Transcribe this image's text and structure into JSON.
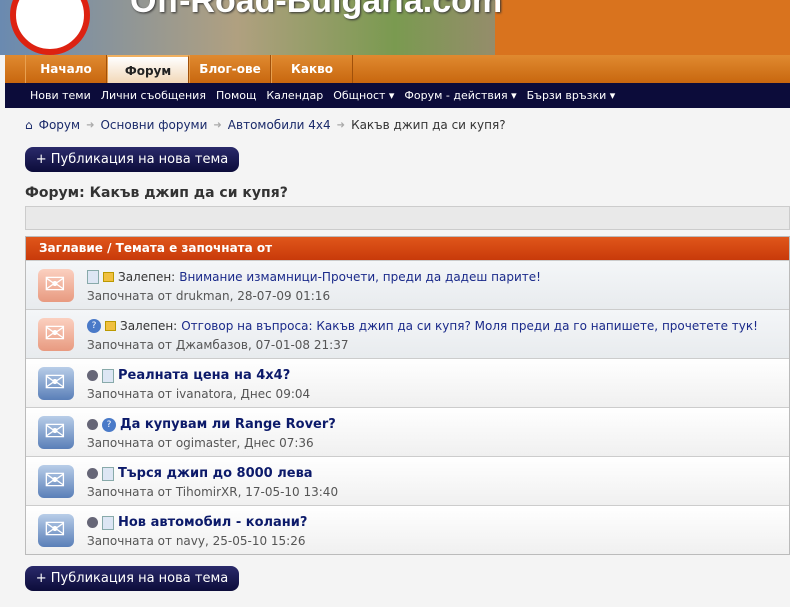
{
  "site": {
    "title": "Off-Road-Bulgaria.com"
  },
  "tabs": [
    "Начало",
    "Форум",
    "Блог-ове",
    "Какво ново?"
  ],
  "subnav": [
    "Нови теми",
    "Лични съобщения",
    "Помощ",
    "Календар",
    "Общност ▾",
    "Форум - действия ▾",
    "Бързи връзки ▾"
  ],
  "breadcrumb": [
    "Форум",
    "Основни форуми",
    "Автомобили 4x4",
    "Какъв джип да си купя?"
  ],
  "new_thread": "+ Публикация на нова тема",
  "forum_title": "Форум: Какъв джип да си купя?",
  "list_header": "Заглавие / Темата е започната от",
  "sticky_label": "Залепен:",
  "threads": [
    {
      "sticky": true,
      "title": "Внимание измамници-Прочети, преди да дадеш парите!",
      "meta": "Започната от drukman, 28-07-09 01:16"
    },
    {
      "sticky": true,
      "title": "Отговор на въпроса: Какъв джип да си купя? Моля преди да го напишете, прочетете тук!",
      "meta": "Започната от Джамбазов, 07-01-08 21:37"
    },
    {
      "sticky": false,
      "title": "Реалната цена на 4x4?",
      "meta": "Започната от ivanatora, Днес 09:04"
    },
    {
      "sticky": false,
      "title": "Да купувам ли Range Rover?",
      "meta": "Започната от ogimaster, Днес 07:36"
    },
    {
      "sticky": false,
      "title": "Търся джип до 8000 лева",
      "meta": "Започната от TihomirXR, 17-05-10 13:40"
    },
    {
      "sticky": false,
      "title": "Нов автомобил - колани?",
      "meta": "Започната от navy, 25-05-10 15:26"
    }
  ]
}
